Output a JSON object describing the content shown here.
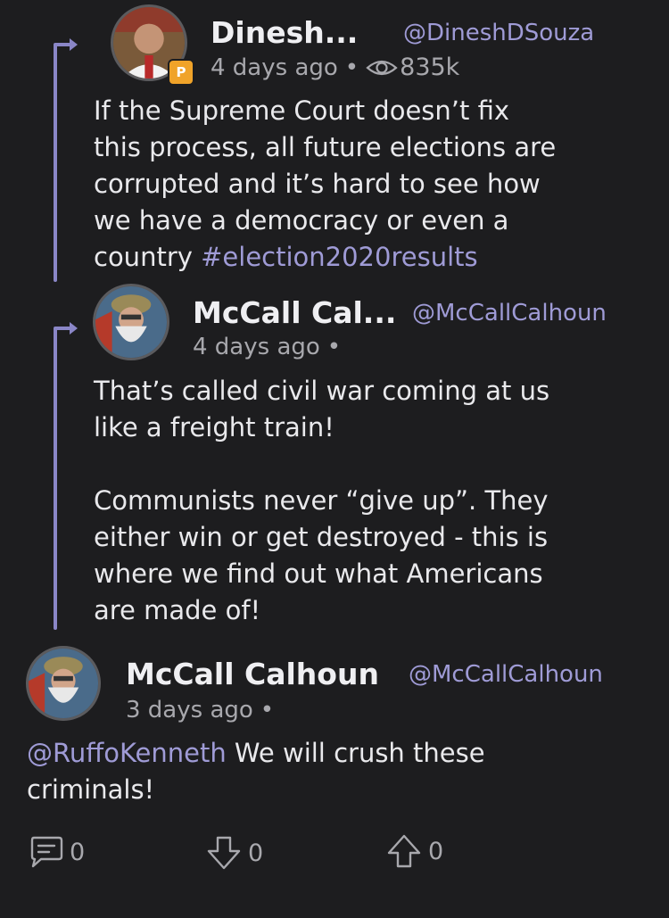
{
  "posts": [
    {
      "name": "Dinesh...",
      "handle": "@DineshDSouza",
      "time": "4 days ago",
      "dot": "•",
      "views": "835k",
      "text_before": "If the Supreme Court doesn’t fix\nthis process, all future elections are\ncorrupted and it’s hard to see how\nwe have a democracy or even a\ncountry ",
      "hashtag": "#election2020results",
      "badge_letter": "P"
    },
    {
      "name": "McCall Cal...",
      "handle": "@McCallCalhoun",
      "time": "4 days ago",
      "dot": "•",
      "text": "That’s called civil war coming at us\nlike a freight train!\n\nCommunists never “give up”. They\neither win or get destroyed - this is\nwhere we find out what Americans\nare made of!"
    },
    {
      "name": "McCall Calhoun",
      "handle": "@McCallCalhoun",
      "time": "3 days ago",
      "dot": "•",
      "mention": "@RuffoKenneth",
      "text_after": " We will crush these\ncriminals!"
    }
  ],
  "actions": {
    "comments": "0",
    "downvotes": "0",
    "upvotes": "0"
  },
  "colors": {
    "background": "#1d1d1f",
    "accent": "#9f9bd6",
    "thread_line": "#8a86c7",
    "badge": "#f0a329"
  },
  "icons": [
    "reply-arrow-icon",
    "eye-icon",
    "comment-icon",
    "downvote-icon",
    "upvote-icon",
    "parler-badge-icon"
  ]
}
